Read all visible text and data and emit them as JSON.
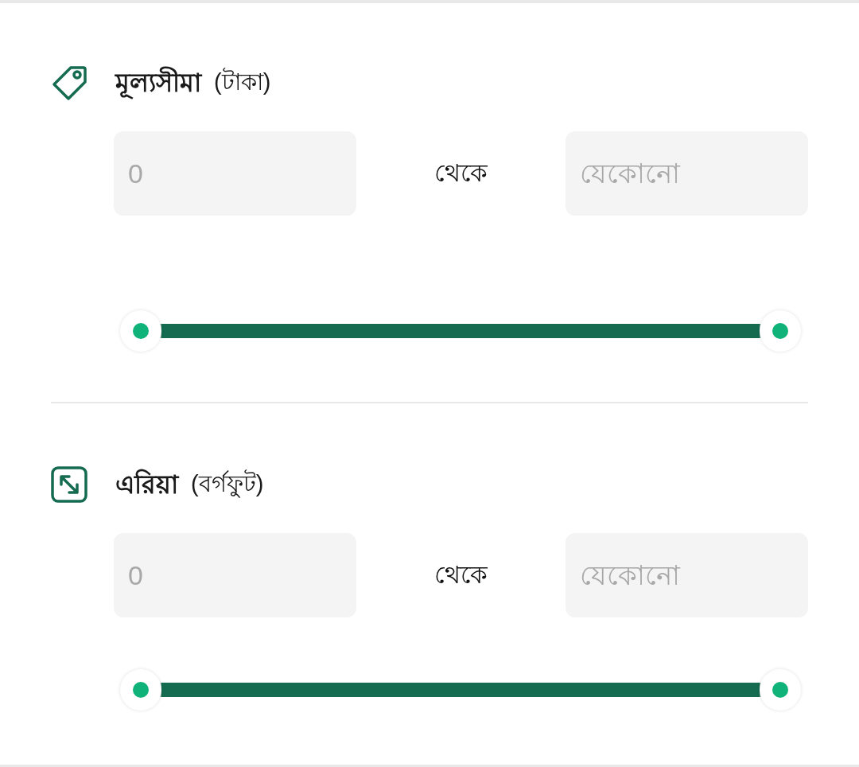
{
  "sections": [
    {
      "kind": "price",
      "title": "মূল্যসীমা",
      "unit": "(টাকা)",
      "min_field": {
        "placeholder": "0"
      },
      "separator": "থেকে",
      "max_field": {
        "placeholder": "যেকোনো"
      }
    },
    {
      "kind": "area",
      "title": "এরিয়া",
      "unit": "(বর্গফুট)",
      "min_field": {
        "placeholder": "0"
      },
      "separator": "থেকে",
      "max_field": {
        "placeholder": "যেকোনো"
      }
    }
  ]
}
